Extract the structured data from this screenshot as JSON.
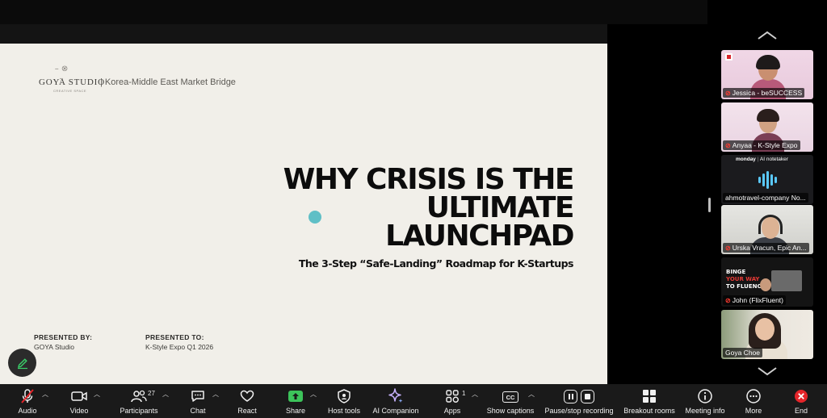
{
  "slide": {
    "logo_mark": "–  ⊗  –",
    "logo_text": "GOYA STUDIO",
    "logo_sub": "CREATIVE SPACE",
    "tagline": "| Korea-Middle East Market Bridge",
    "headline_lines": [
      "WHY CRISIS IS THE",
      "ULTIMATE",
      "LAUNCHPAD"
    ],
    "subtitle": "The 3-Step “Safe-Landing” Roadmap for K-Startups",
    "presented_by_label": "PRESENTED BY:",
    "presented_by_value": "GOYA Studio",
    "presented_to_label": "PRESENTED TO:",
    "presented_to_value": "K-Style Expo Q1 2026",
    "accent_dot_color": "#5fbfc6"
  },
  "participants": [
    {
      "name": "Jessica - beSUCCESS",
      "muted": true
    },
    {
      "name": "Anyaa - K-Style Expo",
      "muted": true
    },
    {
      "name": "ahmotravel-company No...",
      "muted": false,
      "brand": "monday",
      "brand_sub": "AI notetaker"
    },
    {
      "name": "Urska Vracun, Epic An...",
      "muted": true
    },
    {
      "name": "John (FlixFluent)",
      "muted": true,
      "promo": [
        "BINGE",
        "YOUR WAY",
        "TO FLUENC"
      ]
    },
    {
      "name": "Goya Choe",
      "muted": false
    }
  ],
  "toolbar": {
    "audio": "Audio",
    "video": "Video",
    "participants": "Participants",
    "participants_count": "27",
    "chat": "Chat",
    "react": "React",
    "share": "Share",
    "host_tools": "Host tools",
    "ai_companion": "AI Companion",
    "apps": "Apps",
    "apps_count": "1",
    "show_captions": "Show captions",
    "cc": "CC",
    "pause_recording": "Pause/stop recording",
    "breakout_rooms": "Breakout rooms",
    "meeting_info": "Meeting info",
    "more": "More",
    "end": "End"
  },
  "colors": {
    "share_green": "#3cc35a",
    "end_red": "#e5252a",
    "muted_red": "#ff3b30"
  }
}
